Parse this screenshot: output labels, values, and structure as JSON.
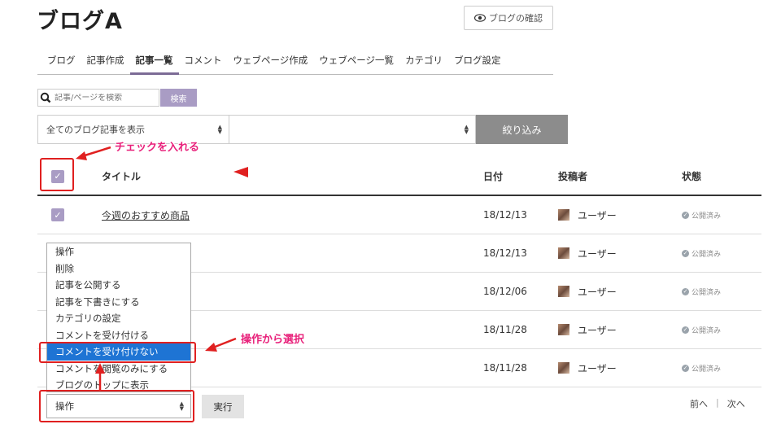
{
  "page": {
    "title": "ブログA",
    "preview_button": "ブログの確認"
  },
  "tabs": [
    {
      "label": "ブログ",
      "active": false
    },
    {
      "label": "記事作成",
      "active": false
    },
    {
      "label": "記事一覧",
      "active": true
    },
    {
      "label": "コメント",
      "active": false
    },
    {
      "label": "ウェブページ作成",
      "active": false
    },
    {
      "label": "ウェブページ一覧",
      "active": false
    },
    {
      "label": "カテゴリ",
      "active": false
    },
    {
      "label": "ブログ設定",
      "active": false
    }
  ],
  "search": {
    "placeholder": "記事/ページを検索",
    "button": "検索"
  },
  "filter": {
    "select1": "全てのブログ記事を表示",
    "select2": "",
    "button": "絞り込み"
  },
  "table": {
    "headers": {
      "title": "タイトル",
      "date": "日付",
      "author": "投稿者",
      "status": "状態"
    },
    "rows": [
      {
        "title": "今週のおすすめ商品",
        "date": "18/12/13",
        "author": "ユーザー",
        "status": "公開済み",
        "checked": true
      },
      {
        "title": "",
        "date": "18/12/13",
        "author": "ユーザー",
        "status": "公開済み",
        "checked": false
      },
      {
        "title": "",
        "date": "18/12/06",
        "author": "ユーザー",
        "status": "公開済み",
        "checked": false
      },
      {
        "title": "",
        "date": "18/11/28",
        "author": "ユーザー",
        "status": "公開済み",
        "checked": false
      },
      {
        "title": "",
        "date": "18/11/28",
        "author": "ユーザー",
        "status": "公開済み",
        "checked": false
      }
    ]
  },
  "bulk": {
    "options": [
      "操作",
      "削除",
      "記事を公開する",
      "記事を下書きにする",
      "カテゴリの設定",
      "コメントを受け付ける",
      "コメントを受け付けない",
      "コメントを閲覧のみにする",
      "ブログのトップに表示"
    ],
    "selected_index": 6,
    "current": "操作",
    "run_button": "実行"
  },
  "pager": {
    "prev": "前へ",
    "sep": "|",
    "next": "次へ"
  },
  "annotations": {
    "check": "チェックを入れる",
    "select": "操作から選択"
  },
  "colors": {
    "accent": "#a99cc4",
    "annotation_red": "#e02020",
    "annotation_pink": "#e8207a",
    "selected_option": "#1e74d4"
  }
}
